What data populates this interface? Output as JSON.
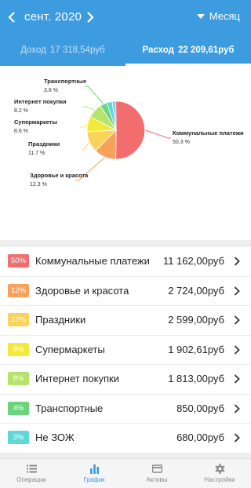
{
  "header": {
    "month": "сент. 2020",
    "period": "Месяц",
    "colors": {
      "header_bg": "#3d9be0"
    }
  },
  "tabs": [
    {
      "label": "Доход",
      "amount": "17 318,54руб",
      "active": false
    },
    {
      "label": "Расход",
      "amount": "22 209,61руб",
      "active": true
    }
  ],
  "chart_data": {
    "type": "pie",
    "slices": [
      {
        "label": "Коммунальные платежи",
        "pct_text": "50.3 %",
        "value": 50.3,
        "color": "#f26d6d"
      },
      {
        "label": "Здоровье и красота",
        "pct_text": "12.3 %",
        "value": 12.3,
        "color": "#f7a15a"
      },
      {
        "label": "Праздники",
        "pct_text": "11.7 %",
        "value": 11.7,
        "color": "#fbd25c"
      },
      {
        "label": "Супермаркеты",
        "pct_text": "8.6 %",
        "value": 8.6,
        "color": "#f3e93a"
      },
      {
        "label": "Интернет покупки",
        "pct_text": "8.2 %",
        "value": 8.2,
        "color": "#b6e36b"
      },
      {
        "label": "Транспортные",
        "pct_text": "3.8 %",
        "value": 3.8,
        "color": "#6cd47a"
      },
      {
        "label": "Не ЗОЖ",
        "pct_text": "",
        "value": 3.1,
        "color": "#5fd8d8"
      },
      {
        "label": "",
        "pct_text": "",
        "value": 2.0,
        "color": "#8cc7ef"
      }
    ]
  },
  "categories": [
    {
      "pct": "50%",
      "name": "Коммунальные платежи",
      "amount": "11 162,00руб",
      "color": "#f26d6d"
    },
    {
      "pct": "12%",
      "name": "Здоровье и красота",
      "amount": "2 724,00руб",
      "color": "#f7a15a"
    },
    {
      "pct": "12%",
      "name": "Праздники",
      "amount": "2 599,00руб",
      "color": "#fbd25c"
    },
    {
      "pct": "9%",
      "name": "Супермаркеты",
      "amount": "1 902,61руб",
      "color": "#f3e93a"
    },
    {
      "pct": "8%",
      "name": "Интернет покупки",
      "amount": "1 813,00руб",
      "color": "#b6e36b"
    },
    {
      "pct": "4%",
      "name": "Транспортные",
      "amount": "850,00руб",
      "color": "#6cd47a"
    },
    {
      "pct": "3%",
      "name": "Не ЗОЖ",
      "amount": "680,00руб",
      "color": "#5fd8d8"
    }
  ],
  "bottom_nav": [
    {
      "label": "Операции",
      "icon": "list-icon",
      "active": false
    },
    {
      "label": "График",
      "icon": "bar-chart-icon",
      "active": true
    },
    {
      "label": "Активы",
      "icon": "card-icon",
      "active": false
    },
    {
      "label": "Настройки",
      "icon": "gear-icon",
      "active": false
    }
  ]
}
